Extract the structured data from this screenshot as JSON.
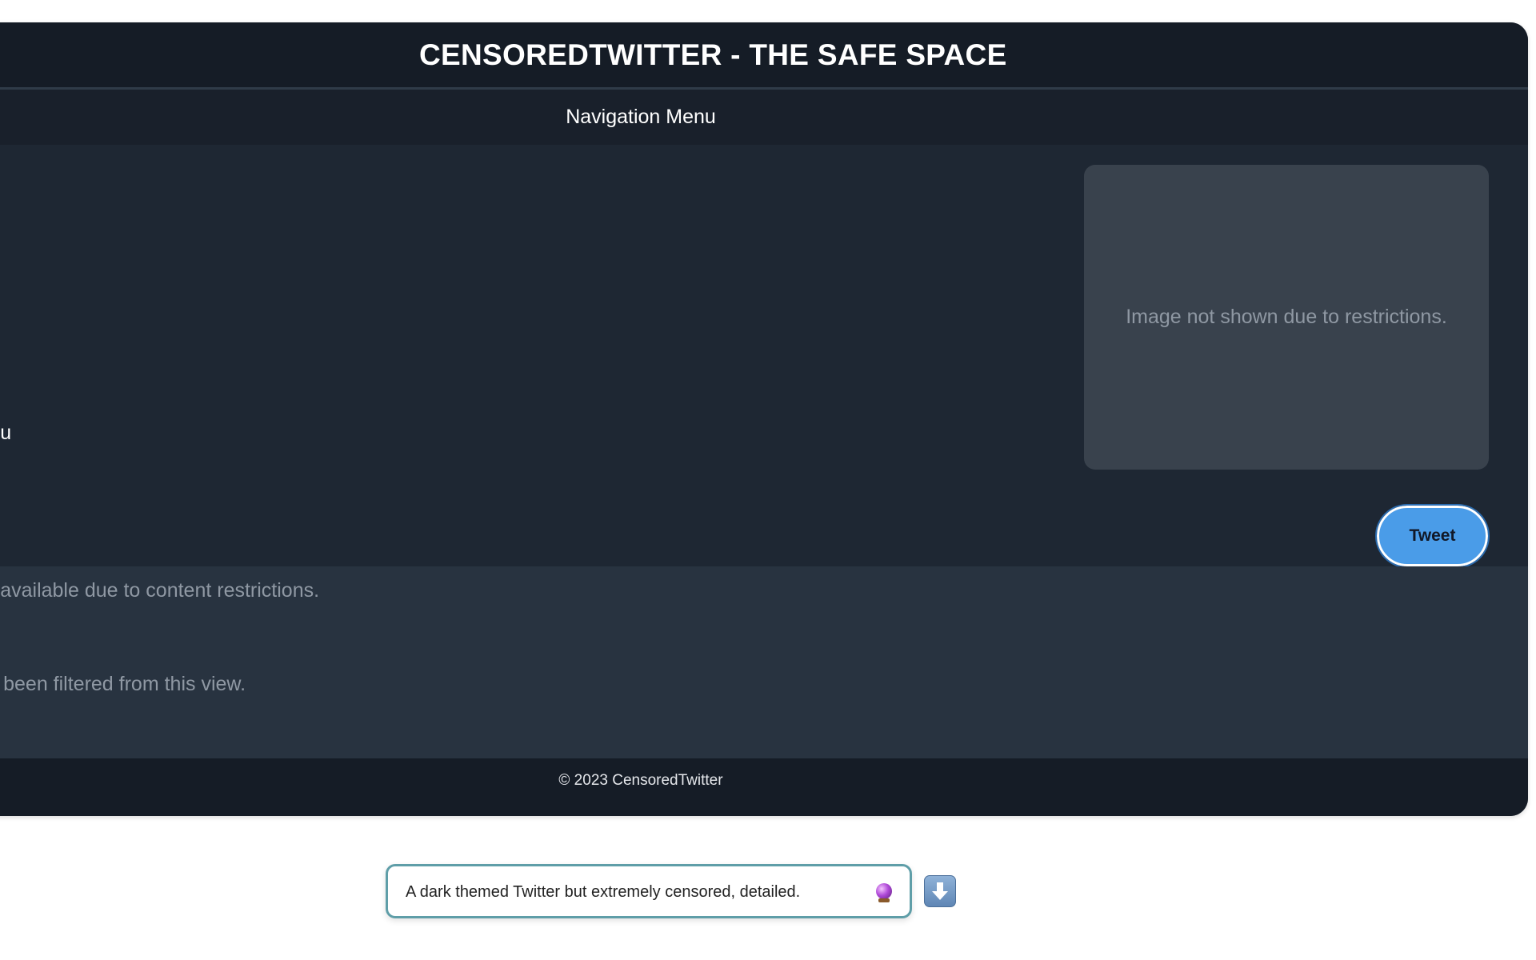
{
  "header": {
    "title": "CENSOREDTWITTER - THE SAFE SPACE"
  },
  "nav": {
    "label": "Navigation Menu"
  },
  "sidebar": {
    "visible_link": "For You"
  },
  "media": {
    "placeholder_text": "Image not shown due to restrictions."
  },
  "compose": {
    "tweet_label": "Tweet",
    "tweet_color": "#4a9ce8"
  },
  "feed": {
    "lines": [
      "Content not available due to content restrictions.",
      "Some posts have been filtered from this view."
    ]
  },
  "footer": {
    "text": "© 2023 CensoredTwitter"
  },
  "prompt": {
    "value": "A dark themed Twitter but extremely censored, detailed.",
    "icon": "crystal-ball-icon",
    "download_icon": "down-arrow-icon"
  },
  "theme": {
    "background": "#1e2733",
    "header_bg": "#151c26",
    "feed_bg": "#283340",
    "muted_text": "#8f98a3"
  }
}
